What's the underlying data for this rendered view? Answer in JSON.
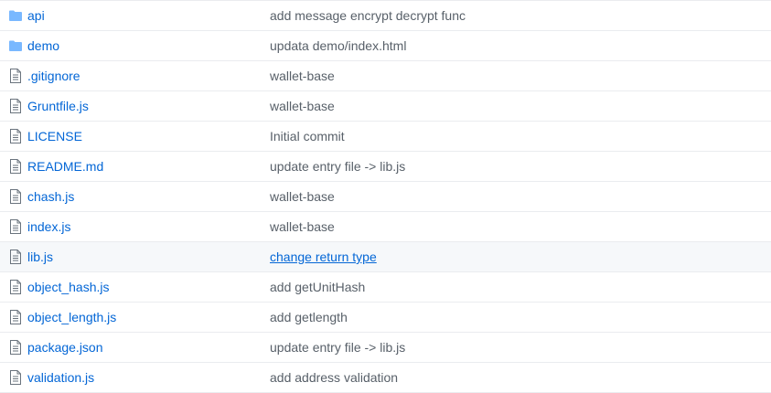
{
  "colors": {
    "link": "#0366d6",
    "message": "#586069",
    "folder_icon": "#79b8ff",
    "file_icon": "#6a737d",
    "border": "#eaecef",
    "hover_bg": "#f6f8fa"
  },
  "files": [
    {
      "name": "api",
      "message": "add message encrypt decrypt func",
      "icon": "folder-icon"
    },
    {
      "name": "demo",
      "message": "updata demo/index.html",
      "icon": "folder-icon"
    },
    {
      "name": ".gitignore",
      "message": "wallet-base",
      "icon": "file-icon"
    },
    {
      "name": "Gruntfile.js",
      "message": "wallet-base",
      "icon": "file-icon"
    },
    {
      "name": "LICENSE",
      "message": "Initial commit",
      "icon": "file-icon"
    },
    {
      "name": "README.md",
      "message": "update entry file -> lib.js",
      "icon": "file-icon"
    },
    {
      "name": "chash.js",
      "message": "wallet-base",
      "icon": "file-icon"
    },
    {
      "name": "index.js",
      "message": "wallet-base",
      "icon": "file-icon"
    },
    {
      "name": "lib.js",
      "message": "change return type",
      "icon": "file-icon",
      "hovered": true
    },
    {
      "name": "object_hash.js",
      "message": "add getUnitHash",
      "icon": "file-icon"
    },
    {
      "name": "object_length.js",
      "message": "add getlength",
      "icon": "file-icon"
    },
    {
      "name": "package.json",
      "message": "update entry file -> lib.js",
      "icon": "file-icon"
    },
    {
      "name": "validation.js",
      "message": "add address validation",
      "icon": "file-icon"
    }
  ]
}
